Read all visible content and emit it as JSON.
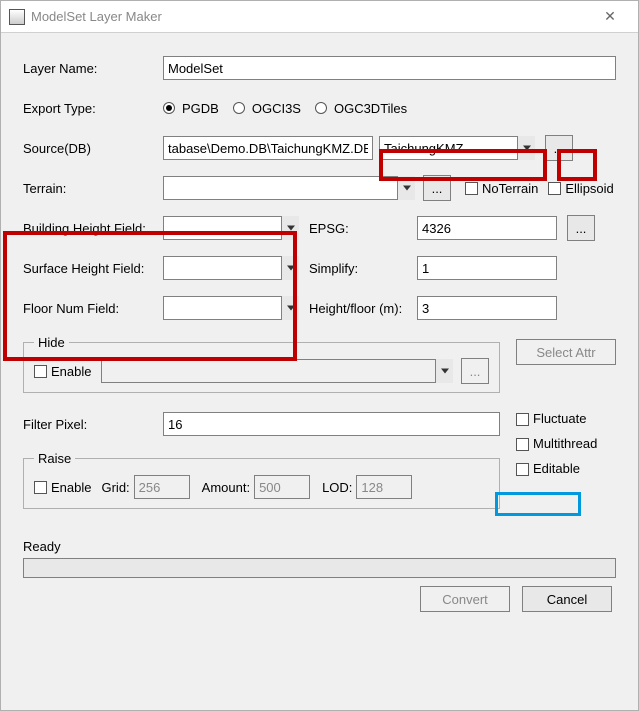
{
  "window": {
    "title": "ModelSet Layer Maker"
  },
  "labels": {
    "layerName": "Layer Name:",
    "exportType": "Export Type:",
    "sourceDB": "Source(DB)",
    "terrain": "Terrain:",
    "buildingHeight": "Building Height Field:",
    "surfaceHeight": "Surface Height Field:",
    "floorNum": "Floor Num Field:",
    "epsg": "EPSG:",
    "simplify": "Simplify:",
    "heightFloor": "Height/floor (m):",
    "filterPixel": "Filter Pixel:",
    "enable": "Enable",
    "grid": "Grid:",
    "amount": "Amount:",
    "lod": "LOD:",
    "hide": "Hide",
    "raise": "Raise",
    "noTerrain": "NoTerrain",
    "ellipsoid": "Ellipsoid",
    "selectAttr": "Select Attr",
    "fluctuate": "Fluctuate",
    "multithread": "Multithread",
    "editable": "Editable",
    "convert": "Convert",
    "cancel": "Cancel",
    "ready": "Ready",
    "browse": "..."
  },
  "values": {
    "layerName": "ModelSet",
    "sourcePath": "tabase\\Demo.DB\\TaichungKMZ.DB",
    "sourceTable": "TaichungKMZ",
    "terrain": "",
    "buildingHeight": "",
    "surfaceHeight": "",
    "floorNum": "",
    "epsg": "4326",
    "simplify": "1",
    "heightFloor": "3",
    "filterPixel": "16",
    "grid": "256",
    "amount": "500",
    "lod": "128",
    "hideEnable": ""
  },
  "exportTypes": {
    "pgdb": "PGDB",
    "ogci3s": "OGCI3S",
    "ogc3dtiles": "OGC3DTiles"
  }
}
